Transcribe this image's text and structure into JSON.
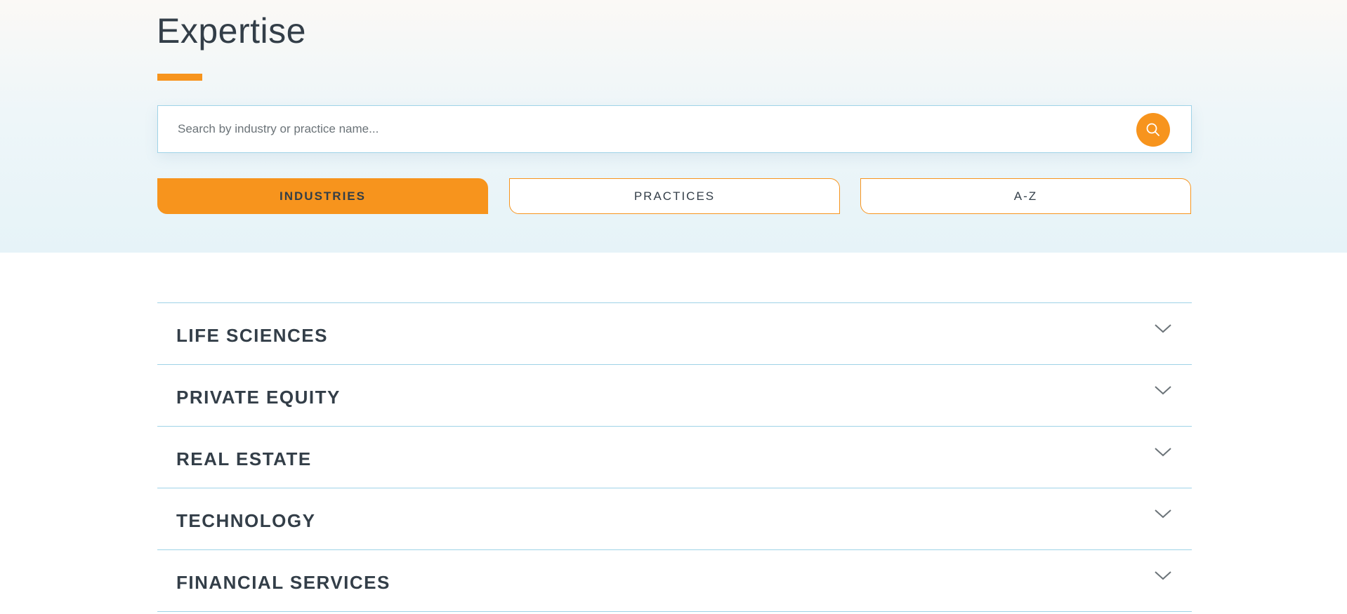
{
  "header": {
    "title": "Expertise"
  },
  "search": {
    "placeholder": "Search by industry or practice name...",
    "value": "",
    "button_icon": "search-icon"
  },
  "tabs": [
    {
      "label": "INDUSTRIES",
      "active": true
    },
    {
      "label": "PRACTICES",
      "active": false
    },
    {
      "label": "A-Z",
      "active": false
    }
  ],
  "accordion": {
    "items": [
      {
        "label": "LIFE SCIENCES",
        "icon": "chevron-down-icon"
      },
      {
        "label": "PRIVATE EQUITY",
        "icon": "chevron-down-icon"
      },
      {
        "label": "REAL ESTATE",
        "icon": "chevron-down-icon"
      },
      {
        "label": "TECHNOLOGY",
        "icon": "chevron-down-icon"
      },
      {
        "label": "FINANCIAL SERVICES",
        "icon": "chevron-down-icon"
      }
    ]
  },
  "colors": {
    "accent": "#f7941d",
    "divider": "#9fd3e7",
    "text": "#333e48",
    "hero_bg": "#e6f3f8"
  }
}
